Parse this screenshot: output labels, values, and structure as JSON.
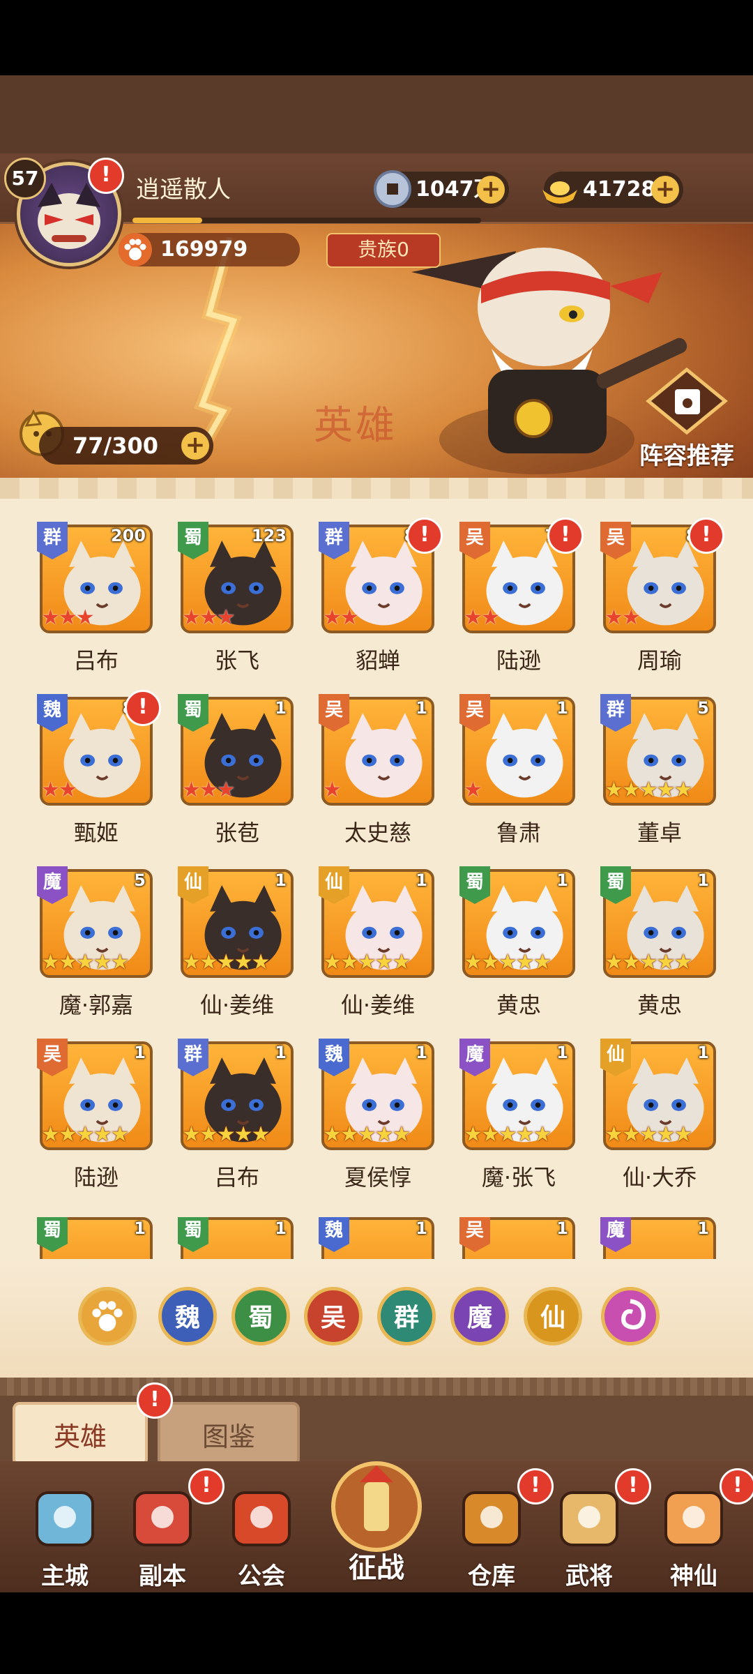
{
  "player": {
    "level": "57",
    "name": "逍遥散人",
    "power": "169979",
    "noble": "贵族0",
    "exp_progress": 0.2
  },
  "currencies": [
    {
      "name": "copper-coin",
      "value": "1047万"
    },
    {
      "name": "gold-ingot",
      "value": "41728"
    }
  ],
  "banner": {
    "watermark": "英雄",
    "capacity": "77/300",
    "lineup_label": "阵容推荐"
  },
  "factions": {
    "群": "#5a6fd0",
    "蜀": "#3f9a4c",
    "吴": "#e06b32",
    "魏": "#4b6ad0",
    "魔": "#8a52c4",
    "仙": "#e5a028"
  },
  "heroes": [
    {
      "name": "吕布",
      "faction": "群",
      "count": "200",
      "stars": 3,
      "star_color": "red",
      "alert": false
    },
    {
      "name": "张飞",
      "faction": "蜀",
      "count": "123",
      "stars": 3,
      "star_color": "red",
      "alert": false
    },
    {
      "name": "貂蝉",
      "faction": "群",
      "count": "80",
      "stars": 2,
      "star_color": "red",
      "alert": true
    },
    {
      "name": "陆逊",
      "faction": "吴",
      "count": "78",
      "stars": 2,
      "star_color": "red",
      "alert": true
    },
    {
      "name": "周瑜",
      "faction": "吴",
      "count": "80",
      "stars": 2,
      "star_color": "red",
      "alert": true
    },
    {
      "name": "甄姬",
      "faction": "魏",
      "count": "80",
      "stars": 2,
      "star_color": "red",
      "alert": true
    },
    {
      "name": "张苞",
      "faction": "蜀",
      "count": "1",
      "stars": 3,
      "star_color": "red",
      "alert": false
    },
    {
      "name": "太史慈",
      "faction": "吴",
      "count": "1",
      "stars": 1,
      "star_color": "red",
      "alert": false
    },
    {
      "name": "鲁肃",
      "faction": "吴",
      "count": "1",
      "stars": 1,
      "star_color": "red",
      "alert": false
    },
    {
      "name": "董卓",
      "faction": "群",
      "count": "5",
      "stars": 5,
      "star_color": "gold",
      "alert": false
    },
    {
      "name": "魔·郭嘉",
      "faction": "魔",
      "count": "5",
      "stars": 5,
      "star_color": "gold",
      "alert": false
    },
    {
      "name": "仙·姜维",
      "faction": "仙",
      "count": "1",
      "stars": 5,
      "star_color": "gold",
      "alert": false
    },
    {
      "name": "仙·姜维",
      "faction": "仙",
      "count": "1",
      "stars": 5,
      "star_color": "gold",
      "alert": false
    },
    {
      "name": "黄忠",
      "faction": "蜀",
      "count": "1",
      "stars": 5,
      "star_color": "gold",
      "alert": false
    },
    {
      "name": "黄忠",
      "faction": "蜀",
      "count": "1",
      "stars": 5,
      "star_color": "gold",
      "alert": false
    },
    {
      "name": "陆逊",
      "faction": "吴",
      "count": "1",
      "stars": 5,
      "star_color": "gold",
      "alert": false
    },
    {
      "name": "吕布",
      "faction": "群",
      "count": "1",
      "stars": 5,
      "star_color": "gold",
      "alert": false
    },
    {
      "name": "夏侯惇",
      "faction": "魏",
      "count": "1",
      "stars": 5,
      "star_color": "gold",
      "alert": false
    },
    {
      "name": "魔·张飞",
      "faction": "魔",
      "count": "1",
      "stars": 5,
      "star_color": "gold",
      "alert": false
    },
    {
      "name": "仙·大乔",
      "faction": "仙",
      "count": "1",
      "stars": 5,
      "star_color": "gold",
      "alert": false
    }
  ],
  "partial_row": [
    {
      "faction": "蜀",
      "count": "1"
    },
    {
      "faction": "蜀",
      "count": "1"
    },
    {
      "faction": "魏",
      "count": "1"
    },
    {
      "faction": "吴",
      "count": "1"
    },
    {
      "faction": "魔",
      "count": "1"
    }
  ],
  "filters": [
    {
      "label": "",
      "icon": "paw-icon",
      "color": "#e8a53a"
    },
    {
      "label": "魏",
      "color": "#3d5fb8"
    },
    {
      "label": "蜀",
      "color": "#3d8f45"
    },
    {
      "label": "吴",
      "color": "#c8432e"
    },
    {
      "label": "群",
      "color": "#2e8a74"
    },
    {
      "label": "魔",
      "color": "#7a44b2"
    },
    {
      "label": "仙",
      "color": "#d8961e"
    },
    {
      "label": "",
      "icon": "swirl-icon",
      "color": "#c84fb0"
    }
  ],
  "tabs": {
    "heroes": "英雄",
    "codex": "图鉴"
  },
  "nav": [
    {
      "label": "主城",
      "icon": "castle-icon",
      "alert": false
    },
    {
      "label": "副本",
      "icon": "sword-icon",
      "alert": true
    },
    {
      "label": "公会",
      "icon": "flag-icon",
      "alert": false
    },
    {
      "label": "征战",
      "icon": "battle-icon",
      "alert": false
    },
    {
      "label": "仓库",
      "icon": "bag-icon",
      "alert": true
    },
    {
      "label": "武将",
      "icon": "hero-icon",
      "alert": true
    },
    {
      "label": "神仙",
      "icon": "immortal-icon",
      "alert": true
    }
  ],
  "alert_mark": "!"
}
